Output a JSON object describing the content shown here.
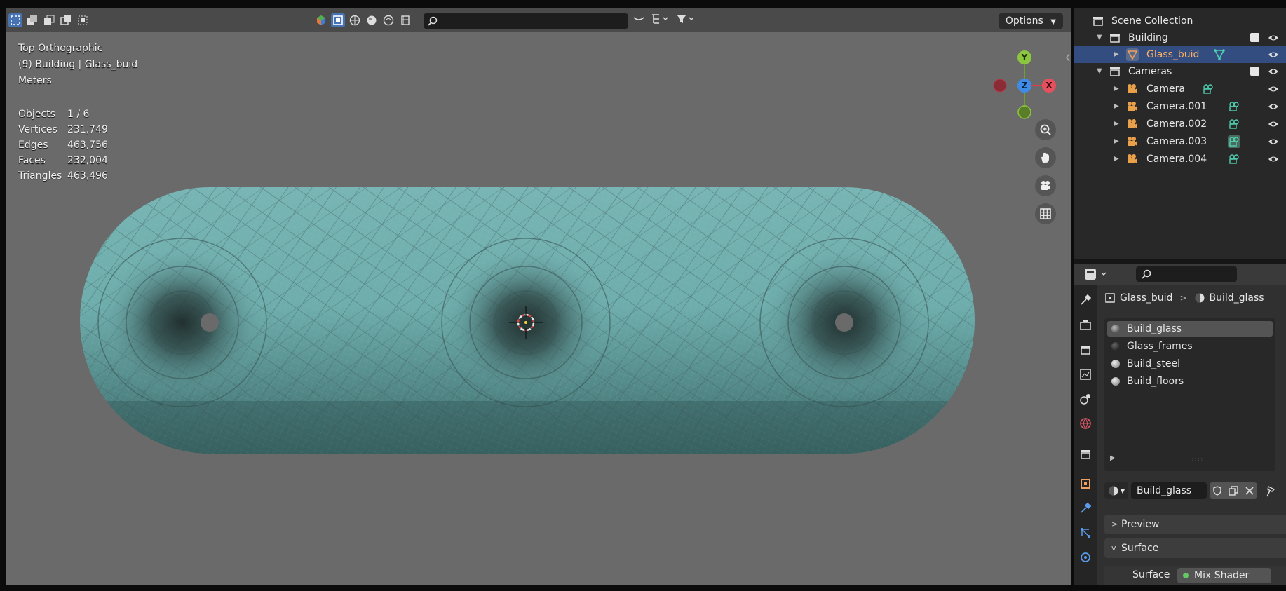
{
  "viewport": {
    "view_name": "Top Orthographic",
    "object_context": "(9) Building | Glass_buid",
    "units": "Meters",
    "stats": [
      {
        "label": "Objects",
        "value": "1 / 6"
      },
      {
        "label": "Vertices",
        "value": "231,749"
      },
      {
        "label": "Edges",
        "value": "463,756"
      },
      {
        "label": "Faces",
        "value": "232,004"
      },
      {
        "label": "Triangles",
        "value": "463,496"
      }
    ],
    "options_label": "Options",
    "gizmo": {
      "y": "Y",
      "z": "Z",
      "x": "X"
    },
    "colors": {
      "mesh": "#5f9fa0",
      "background": "#6a6a6a",
      "header": "#4a4a4a",
      "accent": "#4772b3"
    }
  },
  "outliner": {
    "root": "Scene Collection",
    "items": [
      {
        "label": "Building",
        "type": "collection"
      },
      {
        "label": "Glass_buid",
        "type": "mesh",
        "selected": true
      },
      {
        "label": "Cameras",
        "type": "collection"
      },
      {
        "label": "Camera",
        "type": "camera"
      },
      {
        "label": "Camera.001",
        "type": "camera"
      },
      {
        "label": "Camera.002",
        "type": "camera"
      },
      {
        "label": "Camera.003",
        "type": "camera"
      },
      {
        "label": "Camera.004",
        "type": "camera"
      }
    ]
  },
  "properties": {
    "breadcrumb": {
      "object": "Glass_buid",
      "material": "Build_glass"
    },
    "material_slots": [
      {
        "name": "Build_glass",
        "selected": true
      },
      {
        "name": "Glass_frames"
      },
      {
        "name": "Build_steel"
      },
      {
        "name": "Build_floors"
      }
    ],
    "material_name": "Build_glass",
    "panels": {
      "preview": "Preview",
      "surface": "Surface"
    },
    "surface_label": "Surface",
    "surface_value": "Mix Shader"
  }
}
